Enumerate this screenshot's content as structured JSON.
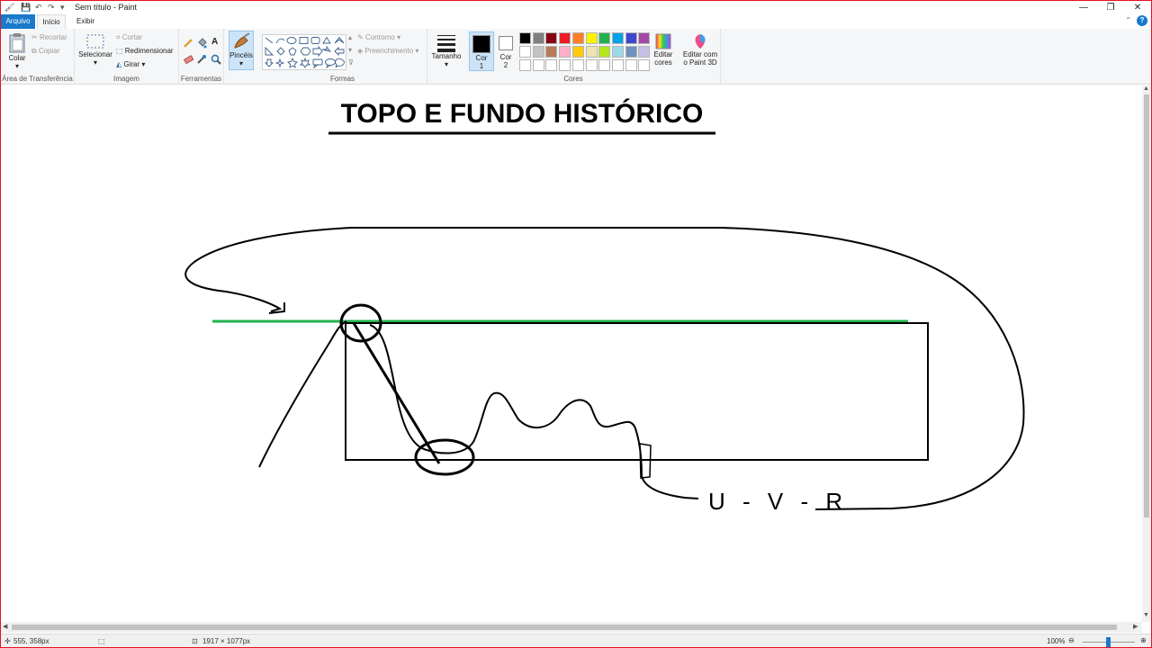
{
  "window": {
    "title": "Sem título - Paint",
    "minimize": "—",
    "restore": "❐",
    "close": "✕"
  },
  "menu": {
    "file": "Arquivo",
    "home": "Início",
    "view": "Exibir",
    "help": "?"
  },
  "clipboard": {
    "paste": "Colar",
    "cut": "Recortar",
    "copy": "Copiar",
    "label": "Área de Transferência"
  },
  "image": {
    "select": "Selecionar",
    "crop": "Cortar",
    "resize": "Redimensionar",
    "rotate": "Girar",
    "label": "Imagem"
  },
  "tools": {
    "label": "Ferramentas",
    "brushes": "Pincéis"
  },
  "shapes": {
    "outline": "Contorno",
    "fill": "Preenchimento",
    "label": "Formas"
  },
  "size": {
    "label": "Tamanho"
  },
  "colors": {
    "color1_label": "Cor",
    "color1_num": "1",
    "color2_label": "Cor",
    "color2_num": "2",
    "edit_label": "Editar",
    "edit_label2": "cores",
    "paint3d_label": "Editar com",
    "paint3d_label2": "o Paint 3D",
    "group_label": "Cores",
    "color1": "#000000",
    "color2": "#ffffff",
    "palette_row1": [
      "#000000",
      "#7f7f7f",
      "#880015",
      "#ed1c24",
      "#ff7f27",
      "#fff200",
      "#22b14c",
      "#00a2e8",
      "#3f48cc",
      "#a349a4"
    ],
    "palette_row2": [
      "#ffffff",
      "#c3c3c3",
      "#b97a57",
      "#ffaec9",
      "#ffc90e",
      "#efe4b0",
      "#b5e61d",
      "#99d9ea",
      "#7092be",
      "#c8bfe7"
    ],
    "palette_row3": [
      "#ffffff",
      "#ffffff",
      "#ffffff",
      "#ffffff",
      "#ffffff",
      "#ffffff",
      "#ffffff",
      "#ffffff",
      "#ffffff",
      "#ffffff"
    ]
  },
  "canvas": {
    "heading": "TOPO E FUNDO HISTÓRICO",
    "handwriting": "U - V - R",
    "green_line_color": "#22b14c"
  },
  "status": {
    "cursor_pos": "555, 358px",
    "image_size": "1917 × 1077px",
    "zoom": "100%"
  }
}
